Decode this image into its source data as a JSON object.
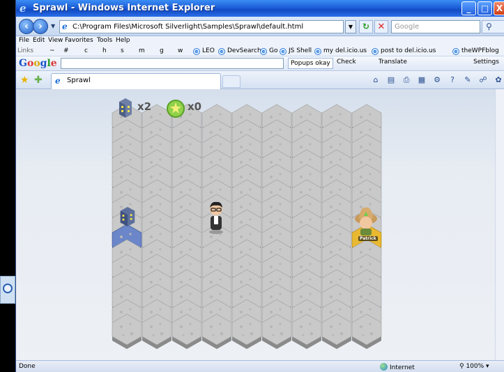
{
  "window": {
    "title": "Sprawl - Windows Internet Explorer",
    "buttons": [
      "_",
      "□",
      "X"
    ]
  },
  "address_bar": {
    "url": "C:\\Program Files\\Microsoft Silverlight\\Samples\\Sprawl\\default.html",
    "search_placeholder": "Google"
  },
  "menu": [
    "File",
    "Edit",
    "View",
    "Favorites",
    "Tools",
    "Help"
  ],
  "links_bar": {
    "label": "Links",
    "items": [
      "~",
      "#",
      "c",
      "h",
      "s",
      "m",
      "g",
      "w",
      "LEO",
      "DevSearch",
      "Go",
      "JS Shell",
      "my del.icio.us",
      "post to del.icio.us",
      "theWPFblog"
    ]
  },
  "google_toolbar": {
    "logo": "Google",
    "popups": "Popups okay",
    "check": "Check",
    "translate": "Translate",
    "settings": "Settings"
  },
  "tab": {
    "title": "Sprawl"
  },
  "game": {
    "buildings_count": "x2",
    "leaves_count": "x0",
    "player_name": "Patrick"
  },
  "status_bar": {
    "status": "Done",
    "zone": "Internet",
    "zoom": "100%"
  },
  "colors": {
    "titlebar": "#1d5fd8",
    "hex_top": "#c9c9c9",
    "hex_side": "#8a8a8a",
    "player_hex": "#e8b830",
    "building_hex": "#6b86c9"
  }
}
